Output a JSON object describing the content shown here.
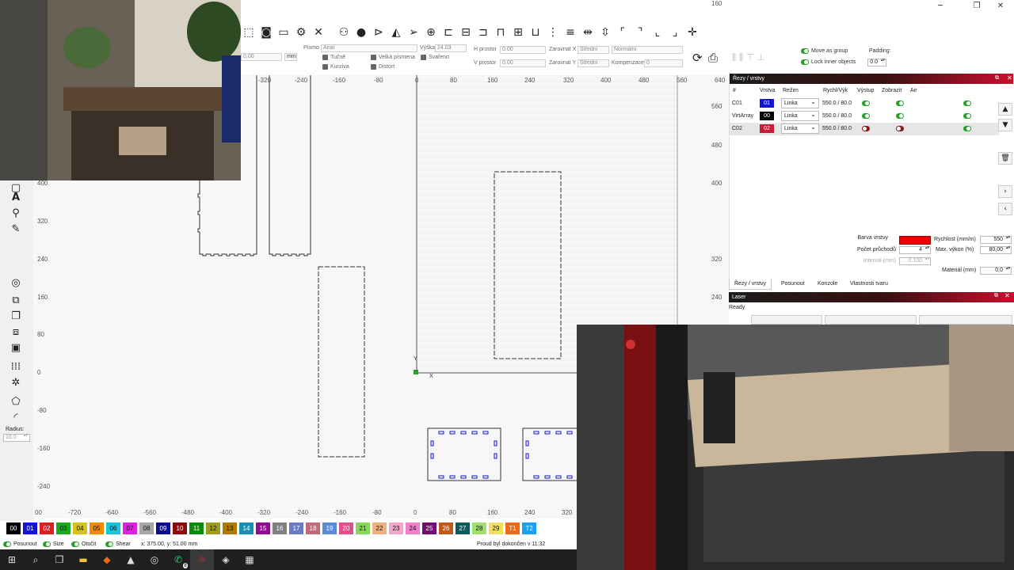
{
  "window": {
    "minimize": "─",
    "restore": "❐",
    "close": "✕"
  },
  "toolbar": {
    "icons": [
      "select-rect-icon",
      "camera-icon",
      "monitor-icon",
      "settings-gear-icon",
      "tools-icon",
      "group-icon",
      "user-icon",
      "flip-h-icon",
      "mirror-icon",
      "send-icon",
      "target-icon",
      "align-left-icon",
      "align-center-icon",
      "align-right-icon",
      "align-top-icon",
      "align-middle-icon",
      "align-bottom-icon",
      "distribute-h-icon",
      "distribute-v-icon",
      "space-h-icon",
      "space-v-icon",
      "corner-tl-icon",
      "corner-tr-icon",
      "corner-bl-icon",
      "corner-br-icon",
      "cross-icon"
    ]
  },
  "textbar": {
    "rotation_value": "0,00",
    "unit": "mm",
    "font_label": "Písmo",
    "font_value": "Arial",
    "height_label": "Výška",
    "height_value": "24.03",
    "hspace_label": "H prostor",
    "hspace_value": "0.00",
    "vspace_label": "V prostor",
    "vspace_value": "0.00",
    "alignx_label": "Zarovnat X",
    "alignx_value": "Střední",
    "aligny_label": "Zarovnat Y",
    "aligny_value": "Střední",
    "style_value": "Normální",
    "compensation_label": "Kompenzace",
    "compensation_value": "0",
    "bold": "Tučně",
    "italic": "Kurzíva",
    "upper": "Velká písmena",
    "welded": "Svařeno",
    "distort": "Distort",
    "move_group": "Move as group",
    "lock_inner": "Lock inner objects",
    "padding_label": "Padding:",
    "padding_value": "0.0"
  },
  "rulers": {
    "top": [
      "-320",
      "-240",
      "-160",
      "-80",
      "0",
      "80",
      "160",
      "240",
      "320",
      "400",
      "480",
      "560",
      "640"
    ],
    "bottom": [
      "00",
      "-720",
      "-640",
      "-560",
      "-480",
      "-400",
      "-320",
      "-240",
      "-160",
      "-80",
      "0",
      "80",
      "160",
      "240",
      "320"
    ],
    "left": [
      "400",
      "320",
      "240",
      "160",
      "80",
      "0",
      "-80",
      "-160",
      "-240"
    ],
    "right": [
      "560",
      "480",
      "400",
      "320",
      "240",
      "160"
    ]
  },
  "left_tools": {
    "icons": [
      "rect-icon",
      "text-icon",
      "pin-icon",
      "pen-icon",
      "circle-icon",
      "copy-icon",
      "duplicate-icon",
      "transform-icon",
      "group-box-icon",
      "grid-array-icon",
      "gear-outline-icon",
      "offset-icon",
      "arc-icon"
    ],
    "radius_label": "Radius:",
    "radius_value": "10.0"
  },
  "layers_panel": {
    "title": "Řezy / vrstvy",
    "columns": [
      "#",
      "Vrstva",
      "Režim",
      "Rychl/Výk",
      "Výstup",
      "Zobrazit",
      "Air"
    ],
    "rows": [
      {
        "name": "C01",
        "layer": "01",
        "color": "#1414d6",
        "mode": "Linka",
        "speed": "550.0 / 80.0",
        "output": true,
        "show": true,
        "air": true
      },
      {
        "name": "VirtArray",
        "layer": "00",
        "color": "#000000",
        "mode": "Linka",
        "speed": "550.0 / 80.0",
        "output": true,
        "show": true,
        "air": true
      },
      {
        "name": "C02",
        "layer": "02",
        "color": "#c41e3a",
        "mode": "Linka",
        "speed": "550.0 / 80.0",
        "output": false,
        "show": false,
        "air": true
      }
    ],
    "layer_color_label": "Barva vrstvy",
    "speed_label": "Rychlost (mm/m)",
    "speed_value": "550",
    "passes_label": "Počet průchodů",
    "passes_value": "4",
    "power_label": "Max. výkon (%)",
    "power_value": "80,00",
    "interval_label": "Interval (mm)",
    "interval_value": "0.100",
    "material_label": "Materiál (mm)",
    "material_value": "0,0",
    "tabs": [
      "Řezy / vrstvy",
      "Posunout",
      "Konzole",
      "Vlastnosti tvaru"
    ]
  },
  "laser_panel": {
    "title": "Laser",
    "status": "Ready"
  },
  "palette": [
    {
      "label": "00",
      "color": "#000000",
      "fg": "#ffffff"
    },
    {
      "label": "01",
      "color": "#1414d6",
      "fg": "#ffffff"
    },
    {
      "label": "02",
      "color": "#e01b24",
      "fg": "#ffffff"
    },
    {
      "label": "03",
      "color": "#1ea81e",
      "fg": "#111111"
    },
    {
      "label": "04",
      "color": "#d2c21a",
      "fg": "#111111"
    },
    {
      "label": "05",
      "color": "#f08a00",
      "fg": "#111111"
    },
    {
      "label": "06",
      "color": "#18c6d8",
      "fg": "#111111"
    },
    {
      "label": "07",
      "color": "#e020e0",
      "fg": "#111111"
    },
    {
      "label": "08",
      "color": "#a7a7a7",
      "fg": "#111111"
    },
    {
      "label": "09",
      "color": "#0c0c8c",
      "fg": "#ffffff"
    },
    {
      "label": "10",
      "color": "#8c0c0c",
      "fg": "#ffffff"
    },
    {
      "label": "11",
      "color": "#0c8c0c",
      "fg": "#ffffff"
    },
    {
      "label": "12",
      "color": "#9c9c1c",
      "fg": "#111111"
    },
    {
      "label": "13",
      "color": "#b07a00",
      "fg": "#111111"
    },
    {
      "label": "14",
      "color": "#1890b0",
      "fg": "#ffffff"
    },
    {
      "label": "15",
      "color": "#900c90",
      "fg": "#ffffff"
    },
    {
      "label": "16",
      "color": "#808080",
      "fg": "#ffffff"
    },
    {
      "label": "17",
      "color": "#6a7cc0",
      "fg": "#ffffff"
    },
    {
      "label": "18",
      "color": "#c06a7c",
      "fg": "#ffffff"
    },
    {
      "label": "19",
      "color": "#5a8ad8",
      "fg": "#ffffff"
    },
    {
      "label": "20",
      "color": "#e0508a",
      "fg": "#ffffff"
    },
    {
      "label": "21",
      "color": "#8ad85a",
      "fg": "#111111"
    },
    {
      "label": "22",
      "color": "#f0b080",
      "fg": "#111111"
    },
    {
      "label": "23",
      "color": "#f0a8c8",
      "fg": "#111111"
    },
    {
      "label": "24",
      "color": "#f080c8",
      "fg": "#111111"
    },
    {
      "label": "25",
      "color": "#700c70",
      "fg": "#ffffff"
    },
    {
      "label": "26",
      "color": "#c05a1a",
      "fg": "#ffffff"
    },
    {
      "label": "27",
      "color": "#0c5a5a",
      "fg": "#ffffff"
    },
    {
      "label": "28",
      "color": "#a0e070",
      "fg": "#111111"
    },
    {
      "label": "29",
      "color": "#f0e060",
      "fg": "#111111"
    },
    {
      "label": "T1",
      "color": "#f06a1a",
      "fg": "#ffffff"
    },
    {
      "label": "T2",
      "color": "#1aa0f0",
      "fg": "#ffffff"
    }
  ],
  "statusbar": {
    "move": "Posunout",
    "size": "Size",
    "rotate": "Otočit",
    "shear": "Shear",
    "coords": "x: 375.00, y: 51.00 mm",
    "message": "Proud byl dokončen v 11:32"
  },
  "taskbar": {
    "icons": [
      "windows-start-icon",
      "search-icon",
      "task-view-icon",
      "file-explorer-icon",
      "brave-browser-icon",
      "inkscape-icon",
      "chrome-icon",
      "whatsapp-icon",
      "lightburn-icon",
      "app-icon",
      "calculator-icon"
    ],
    "whatsapp_badge": "8"
  }
}
